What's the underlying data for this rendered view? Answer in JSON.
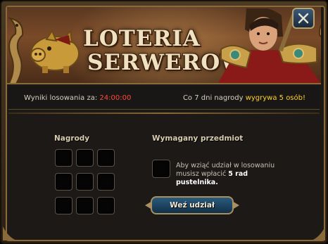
{
  "banner": {
    "title_line1": "LOTERIA",
    "title_line2": "SERWEROWA"
  },
  "close_button": {
    "icon": "close-x-icon"
  },
  "info_bar": {
    "results_label": "Wyniki losowania za:",
    "countdown": "24:00:00",
    "prize_text_prefix": "Co 7 dni nagrody",
    "prize_text_highlight": "wygrywa 5 osób!"
  },
  "rewards": {
    "heading": "Nagrody",
    "slots_count": 9
  },
  "required_item": {
    "heading": "Wymagany przedmiot",
    "desc_prefix": "Aby wziąć udział w losowaniu musisz wpłacić",
    "desc_amount": "5 rad pustelnika."
  },
  "join_button": {
    "label": "Weź udział"
  },
  "colors": {
    "accent_red": "#ff4a3a",
    "accent_yellow": "#ffd030",
    "button_blue": "#2a5a7c",
    "frame_gold": "#8a6a3a"
  }
}
